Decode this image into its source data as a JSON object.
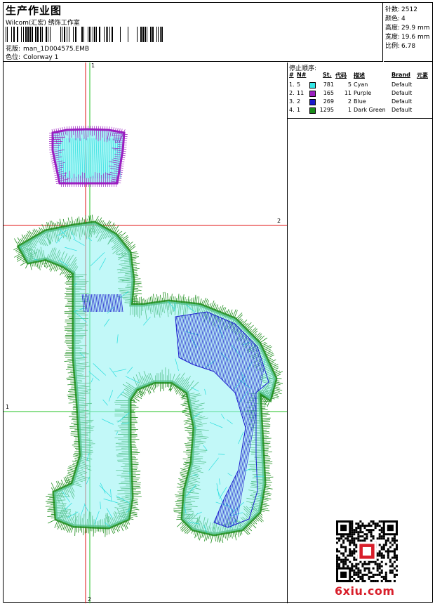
{
  "header": {
    "title": "生产作业图",
    "company": "Wilcom(汇宏) 绣饰工作室",
    "pattern_label": "花版:",
    "pattern_value": "man_1D004575.EMB",
    "colorway_label": "色位:",
    "colorway_value": "Colorway 1"
  },
  "stats": [
    {
      "label": "针数:",
      "value": "2512"
    },
    {
      "label": "颜色:",
      "value": "4"
    },
    {
      "label": "高度:",
      "value": "29.9 mm"
    },
    {
      "label": "宽度:",
      "value": "19.6 mm"
    },
    {
      "label": "比例:",
      "value": "6.78"
    }
  ],
  "stop_sequence": {
    "title": "停止顺序:",
    "columns": [
      "#",
      "N#",
      "St.",
      "代码",
      "描述",
      "Brand",
      "元素"
    ],
    "rows": [
      {
        "idx": "1.",
        "n": "5",
        "st": "781",
        "code": "5",
        "desc": "Cyan",
        "brand": "Default",
        "color": "#33e6e6"
      },
      {
        "idx": "2.",
        "n": "11",
        "st": "165",
        "code": "11",
        "desc": "Purple",
        "brand": "Default",
        "color": "#9b1fc0"
      },
      {
        "idx": "3.",
        "n": "2",
        "st": "269",
        "code": "2",
        "desc": "Blue",
        "brand": "Default",
        "color": "#1a1acc"
      },
      {
        "idx": "4.",
        "n": "1",
        "st": "1295",
        "code": "1",
        "desc": "Dark Green",
        "brand": "Default",
        "color": "#1a8c1a"
      }
    ]
  },
  "guides": {
    "v1_top": "1",
    "v2_bottom": "2",
    "h2_right": "2",
    "h1_left": "1"
  },
  "watermark": "6xiu.com",
  "colors": {
    "cyan": "#33e6e6",
    "purple": "#9b1fc0",
    "blue": "#1a1acc",
    "green": "#1a8c1a",
    "guide_red": "#e01010",
    "guide_green": "#20c020"
  }
}
